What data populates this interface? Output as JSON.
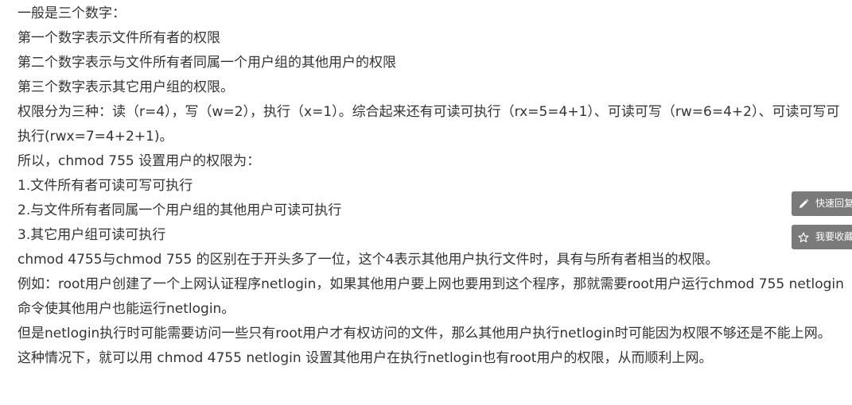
{
  "article": {
    "paragraphs": [
      "一般是三个数字：",
      "第一个数字表示文件所有者的权限",
      "第二个数字表示与文件所有者同属一个用户组的其他用户的权限",
      "第三个数字表示其它用户组的权限。",
      "权限分为三种：读（r=4），写（w=2），执行（x=1）。综合起来还有可读可执行（rx=5=4+1）、可读可写（rw=6=4+2）、可读可写可执行(rwx=7=4+2+1)。",
      "所以，chmod 755 设置用户的权限为：",
      "1.文件所有者可读可写可执行",
      "2.与文件所有者同属一个用户组的其他用户可读可执行",
      "3.其它用户组可读可执行",
      "chmod 4755与chmod 755 的区别在于开头多了一位，这个4表示其他用户执行文件时，具有与所有者相当的权限。",
      "例如：root用户创建了一个上网认证程序netlogin，如果其他用户要上网也要用到这个程序，那就需要root用户运行chmod 755 netlogin命令使其他用户也能运行netlogin。",
      "但是netlogin执行时可能需要访问一些只有root用户才有权访问的文件，那么其他用户执行netlogin时可能因为权限不够还是不能上网。",
      "这种情况下，就可以用 chmod 4755 netlogin 设置其他用户在执行netlogin也有root用户的权限，从而顺利上网。"
    ]
  },
  "float_buttons": {
    "quick_reply_label": "快速回复",
    "quick_reply_icon": "pencil-icon",
    "favorite_label": "我要收藏",
    "favorite_icon": "star-icon",
    "bg_color": "#7a7a7a"
  }
}
